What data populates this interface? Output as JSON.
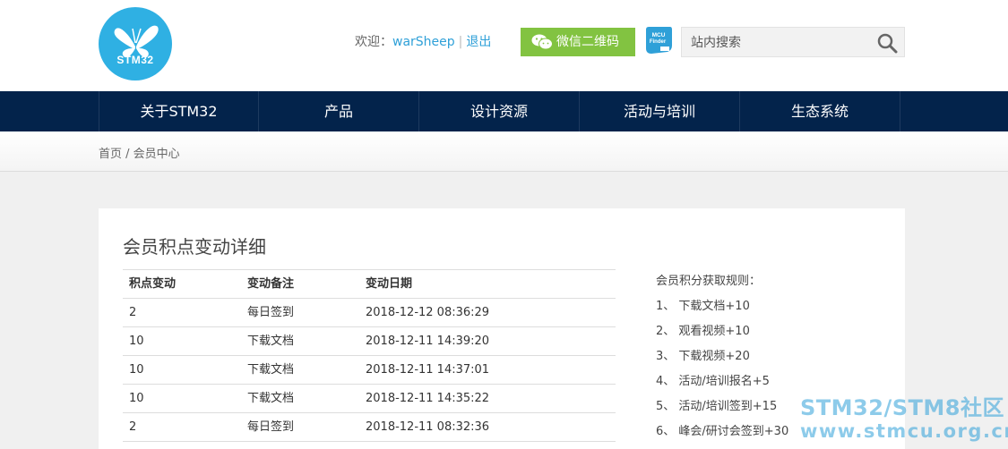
{
  "header": {
    "logo_text": "STM32",
    "welcome_label": "欢迎：",
    "username": "warSheep",
    "separator": "|",
    "logout_label": "退出",
    "wechat_label": "微信二维码",
    "mcu_finder_text_1": "MCU",
    "mcu_finder_text_2": "Finder",
    "search_placeholder": "站内搜索"
  },
  "nav": {
    "items": [
      {
        "label": "关于STM32"
      },
      {
        "label": "产品"
      },
      {
        "label": "设计资源"
      },
      {
        "label": "活动与培训"
      },
      {
        "label": "生态系统"
      }
    ]
  },
  "breadcrumb": {
    "text": "首页 / 会员中心"
  },
  "panel": {
    "title": "会员积点变动详细",
    "columns": [
      "积点变动",
      "变动备注",
      "变动日期"
    ],
    "rows": [
      [
        "2",
        "每日签到",
        "2018-12-12 08:36:29"
      ],
      [
        "10",
        "下载文档",
        "2018-12-11 14:39:20"
      ],
      [
        "10",
        "下载文档",
        "2018-12-11 14:37:01"
      ],
      [
        "10",
        "下载文档",
        "2018-12-11 14:35:22"
      ],
      [
        "2",
        "每日签到",
        "2018-12-11 08:32:36"
      ]
    ],
    "rules_title": "会员积分获取规则：",
    "rules": [
      "1、 下载文档+10",
      "2、 观看视频+10",
      "3、 下载视频+20",
      "4、 活动/培训报名+5",
      "5、 活动/培训签到+15",
      "6、 峰会/研讨会签到+30"
    ]
  },
  "watermark": {
    "line1": "STM32/STM8社区",
    "line2": "www.stmcu.org.cn"
  },
  "colors": {
    "nav_bg": "#03234b",
    "accent_blue": "#2fb0e3",
    "wechat_green": "#82c341"
  }
}
